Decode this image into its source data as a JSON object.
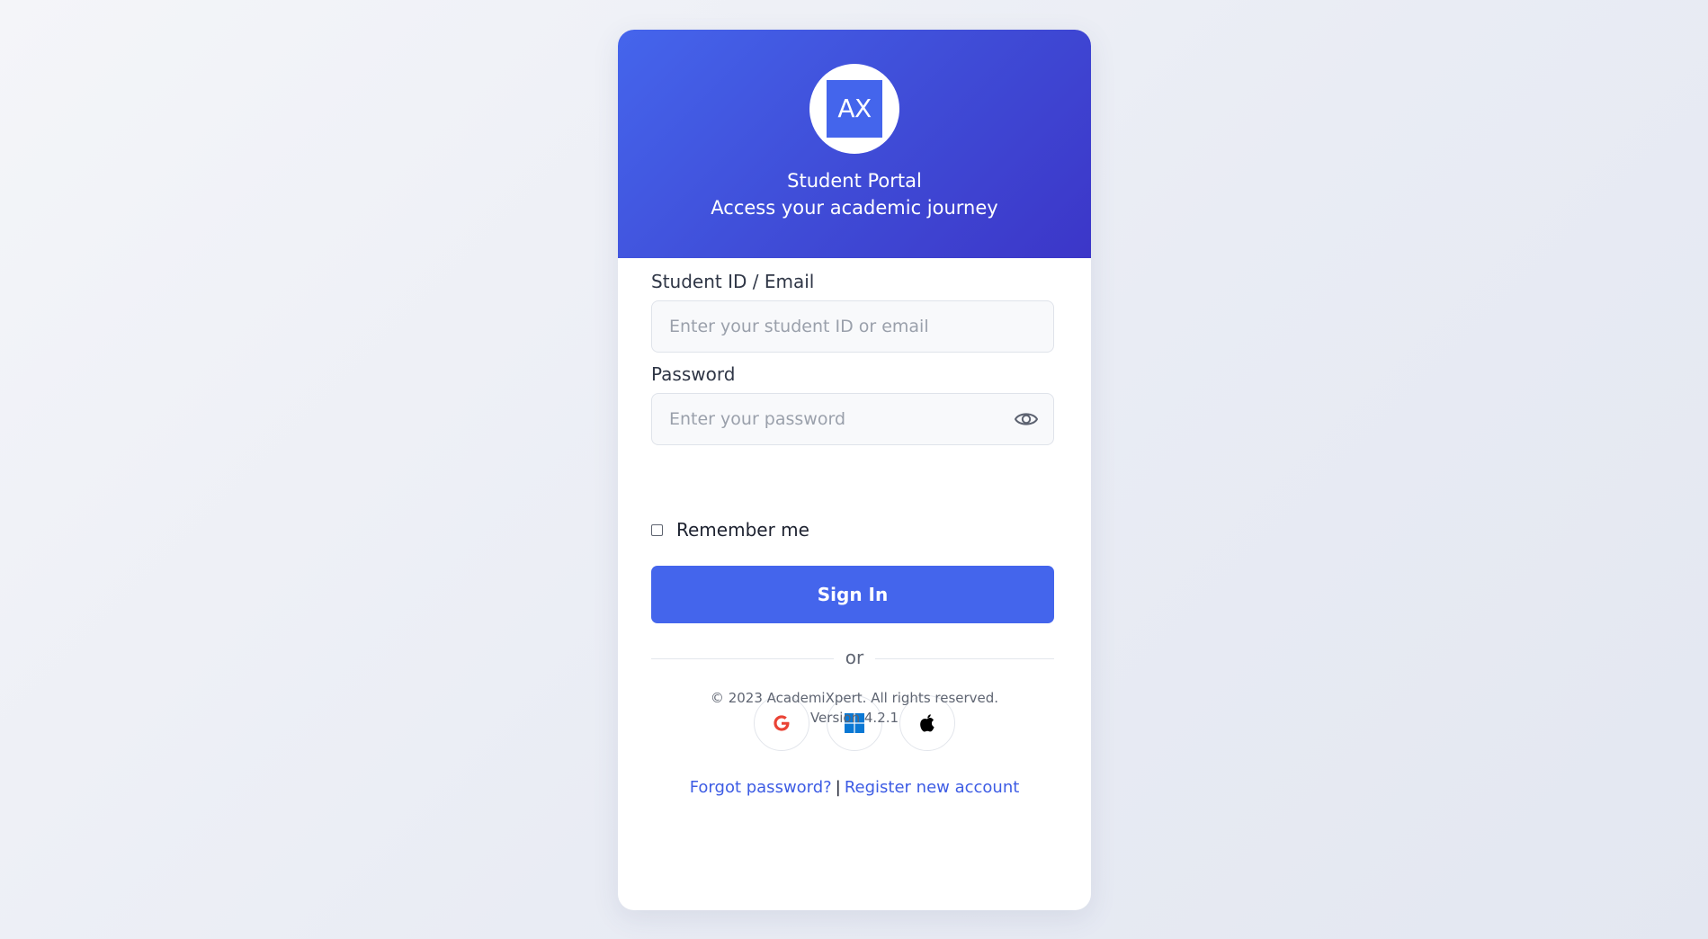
{
  "header": {
    "logo_text": "AX",
    "title": "Student Portal",
    "subtitle": "Access your academic journey"
  },
  "form": {
    "id_label": "Student ID / Email",
    "id_value": "",
    "id_placeholder": "Enter your student ID or email",
    "password_label": "Password",
    "password_value": "",
    "password_placeholder": "Enter your password",
    "password_toggle_icon": "eye-icon",
    "remember_label": "Remember me",
    "remember_checked": false,
    "signin_label": "Sign In"
  },
  "divider_text": "or",
  "social": [
    {
      "name": "google",
      "icon": "google-icon",
      "color": "#ea4335"
    },
    {
      "name": "microsoft",
      "icon": "windows-icon",
      "color": "#0a78d4"
    },
    {
      "name": "apple",
      "icon": "apple-icon",
      "color": "#000000"
    }
  ],
  "links": {
    "forgot": "Forgot password?",
    "separator": "|",
    "register": "Register new account"
  },
  "footer": {
    "copyright": "© 2023 AcademiXpert. All rights reserved.",
    "version": "Version 4.2.1"
  },
  "colors": {
    "primary": "#4465ec",
    "header_gradient_start": "#4565ec",
    "header_gradient_end": "#3c36c8",
    "link": "#3d5ce4"
  }
}
